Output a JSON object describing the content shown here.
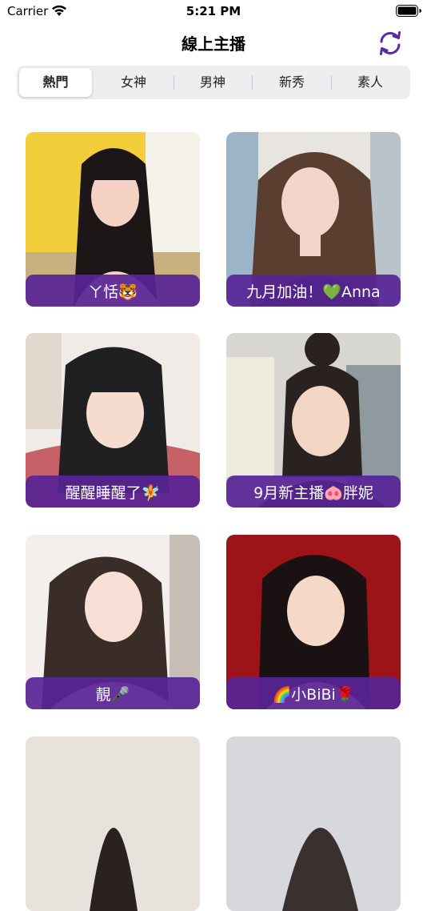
{
  "status_bar": {
    "carrier": "Carrier",
    "time": "5:21 PM"
  },
  "nav": {
    "title": "線上主播",
    "refresh_icon": "refresh-icon"
  },
  "tabs": [
    {
      "label": "熱門",
      "active": true
    },
    {
      "label": "女神",
      "active": false
    },
    {
      "label": "男神",
      "active": false
    },
    {
      "label": "新秀",
      "active": false
    },
    {
      "label": "素人",
      "active": false
    }
  ],
  "streamers": [
    {
      "name": "ㄚ恬🐯"
    },
    {
      "name": "九月加油！💚Anna"
    },
    {
      "name": "醒醒睡醒了🧚"
    },
    {
      "name": "9月新主播🐽胖妮"
    },
    {
      "name": "靚🎤"
    },
    {
      "name": "🌈小BiBi🌹"
    }
  ],
  "colors": {
    "accent": "#5a2aa0",
    "label_bar": "#582496",
    "segment_bg": "#eeeef0"
  }
}
